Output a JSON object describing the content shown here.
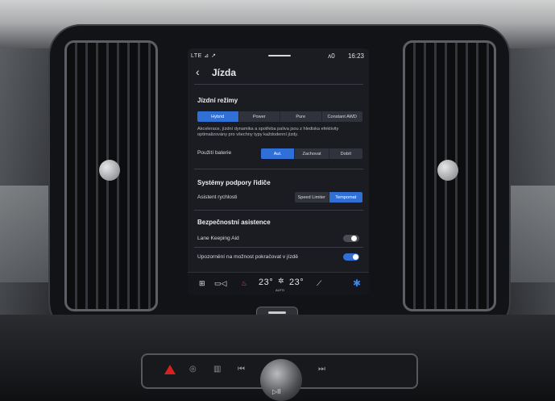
{
  "status_bar": {
    "signal": "LTE ⊿ ↗",
    "indicator": "ʌ0",
    "time": "16:23"
  },
  "header": {
    "title": "Jízda"
  },
  "drive_modes": {
    "title": "Jízdní režimy",
    "options": [
      "Hybrid",
      "Power",
      "Pure",
      "Constant AWD"
    ],
    "selected": "Hybrid",
    "description": "Akcelerace, jízdní dynamika a spotřeba paliva jsou z hlediska efektivity optimalizovány pro všechny typy každodenní jízdy."
  },
  "battery": {
    "label": "Použití baterie",
    "options": [
      "Aut.",
      "Zachovat",
      "Dobít"
    ],
    "selected": "Aut."
  },
  "driver_support": {
    "title": "Systémy podpory řidiče",
    "speed_assist": {
      "label": "Asistent rychlosti",
      "options": [
        "Speed Limiter",
        "Tempomat"
      ],
      "selected": "Tempomat"
    }
  },
  "safety": {
    "title": "Bezpečnostní asistence",
    "lane_keeping": {
      "label": "Lane Keeping Aid",
      "enabled": false
    },
    "continue_driving": {
      "label": "Upozornění na možnost pokračovat v jízdě",
      "enabled": true
    }
  },
  "bottom_bar": {
    "grid_icon": "⊞",
    "camera_icon": "▭◁",
    "seat_heat_icon": "♨",
    "temp_left": "23°",
    "fan_icon": "✲",
    "auto_label": "AUTO",
    "temp_right": "23°",
    "seat_icon": "⟋",
    "settings_icon": "✱"
  },
  "physical_controls": {
    "defrost_icon": "◎",
    "rear_defrost_icon": "▥",
    "prev_icon": "⏮",
    "next_icon": "⏭",
    "play_pause_icon": "▷II"
  },
  "colors": {
    "accent": "#2f6fd6",
    "screen_bg": "#1a1c22",
    "hazard": "#d82020"
  }
}
